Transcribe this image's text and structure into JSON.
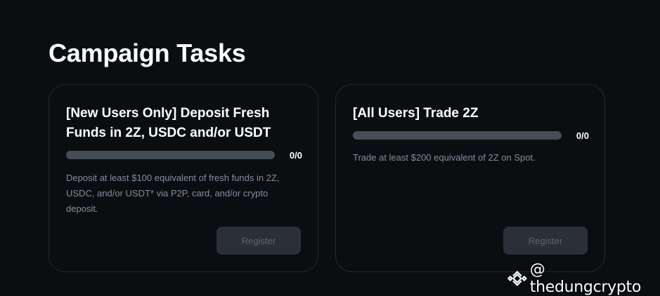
{
  "section": {
    "title": "Campaign Tasks"
  },
  "tasks": [
    {
      "title": "[New Users Only] Deposit Fresh Funds in 2Z, USDC and/or USDT",
      "progress": {
        "done": 0,
        "total": 0,
        "label": "0/0"
      },
      "description": "Deposit at least $100 equivalent of fresh funds in 2Z, USDC, and/or USDT* via P2P, card, and/or crypto deposit.",
      "button_label": "Register",
      "button_disabled": true
    },
    {
      "title": "[All Users] Trade 2Z",
      "progress": {
        "done": 0,
        "total": 0,
        "label": "0/0"
      },
      "description": "Trade at least $200 equivalent of 2Z on Spot.",
      "button_label": "Register",
      "button_disabled": true
    }
  ],
  "watermark": {
    "icon": "binance-logo-icon",
    "text": "@ thedungcrypto"
  },
  "colors": {
    "background": "#0b0e11",
    "card_border": "#24272c",
    "progress_track": "#474d57",
    "button_bg": "#2b2f36",
    "button_text": "#5e6673",
    "description": "#848e9c"
  }
}
